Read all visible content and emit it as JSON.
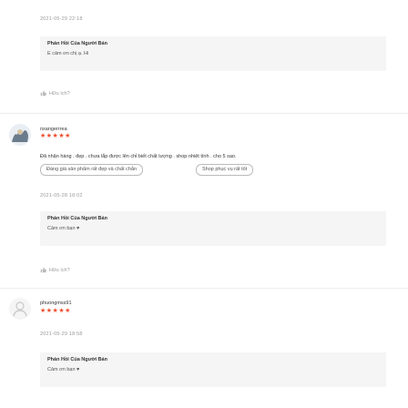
{
  "reviews": [
    {
      "timestamp": "2021-05-29 22:18",
      "seller_reply_title": "Phản Hồi Của Người Bán",
      "seller_reply_text": "E cảm ơn chị ạ. Hi",
      "helpful_label": "Hữu ích?"
    },
    {
      "username": "nxangerrrea",
      "stars": "★★★★★",
      "comment": "Đã nhận hàng . đẹp . chưa lắp được lên chỉ biết chất lượng . shop nhiệt tình . cho 5 sao.",
      "tags": [
        "Đáng giá sản phẩm rất đẹp và chất chắn",
        "Shop phục vụ rất tốt"
      ],
      "timestamp": "2021-05-28 18:02",
      "seller_reply_title": "Phản Hồi Của Người Bán",
      "seller_reply_text": "Cảm ơn bạn ♥",
      "helpful_label": "Hữu ích?"
    },
    {
      "username": "phuongmss91",
      "stars": "★★★★★",
      "timestamp": "2021-05-29 18:58",
      "seller_reply_title": "Phản Hồi Của Người Bán",
      "seller_reply_text": "Cảm ơn bạn ♥"
    }
  ],
  "colors": {
    "accent": "#ee4d2d",
    "reply_bg": "#f5f5f5",
    "muted": "#9a9a9a"
  },
  "icons": {
    "helpful": "thumb-up-icon",
    "avatar_default": "user-silhouette-icon"
  }
}
